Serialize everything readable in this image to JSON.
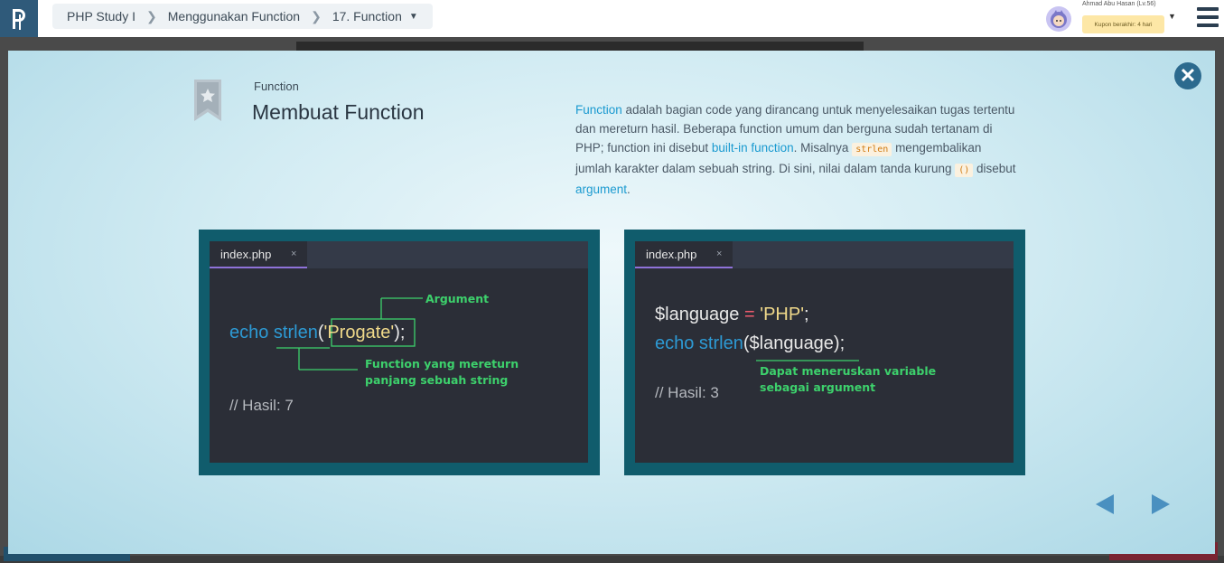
{
  "breadcrumb": {
    "course": "PHP Study I",
    "chapter": "Menggunakan Function",
    "lesson": "17. Function"
  },
  "user": {
    "name": "Ahmad Abu Hasan (Lv.56)",
    "coupon": "Kupon berakhir: 4 hari"
  },
  "slide": {
    "section_label": "Function",
    "title": "Membuat Function",
    "desc": {
      "w1": "Function",
      "t1": " adalah bagian code yang dirancang untuk menyelesaikan tugas tertentu dan mereturn hasil. Beberapa function umum dan berguna sudah tertanam di PHP; function ini disebut ",
      "w2": "built-in function",
      "t2": ". Misalnya ",
      "c1": "strlen",
      "t3": " mengembalikan jumlah karakter dalam sebuah string. Di sini, nilai dalam tanda kurung ",
      "c2": "()",
      "t4": " disebut ",
      "w3": "argument",
      "t5": "."
    }
  },
  "left_panel": {
    "tab": "index.php",
    "tab_close": "×",
    "code_kw": "echo strlen",
    "code_open": "(",
    "code_str": "'Progate'",
    "code_close": ");",
    "comment": "// Hasil: 7",
    "note_argument": "Argument",
    "note_function_1": "Function yang mereturn",
    "note_function_2": "panjang sebuah string"
  },
  "right_panel": {
    "tab": "index.php",
    "tab_close": "×",
    "line1_var": "$language",
    "line1_op": "=",
    "line1_str": "'PHP'",
    "line1_end": ";",
    "line2_kw": "echo strlen",
    "line2_rest": "($language);",
    "comment": "// Hasil: 3",
    "note_1": "Dapat meneruskan variable",
    "note_2": "sebagai argument"
  },
  "colors": {
    "accent": "#1a9ad0",
    "keyword": "#2d9ad4",
    "string": "#f0d98a",
    "annotation": "#3dd16c",
    "panel_frame": "#105c6c",
    "nav_arrow": "#4a90c0"
  },
  "icons": {
    "logo": "progate-logo-icon",
    "close": "close-icon",
    "bookmark": "bookmark-star-icon",
    "prev": "prev-arrow-icon",
    "next": "next-arrow-icon",
    "menu": "hamburger-menu-icon"
  }
}
